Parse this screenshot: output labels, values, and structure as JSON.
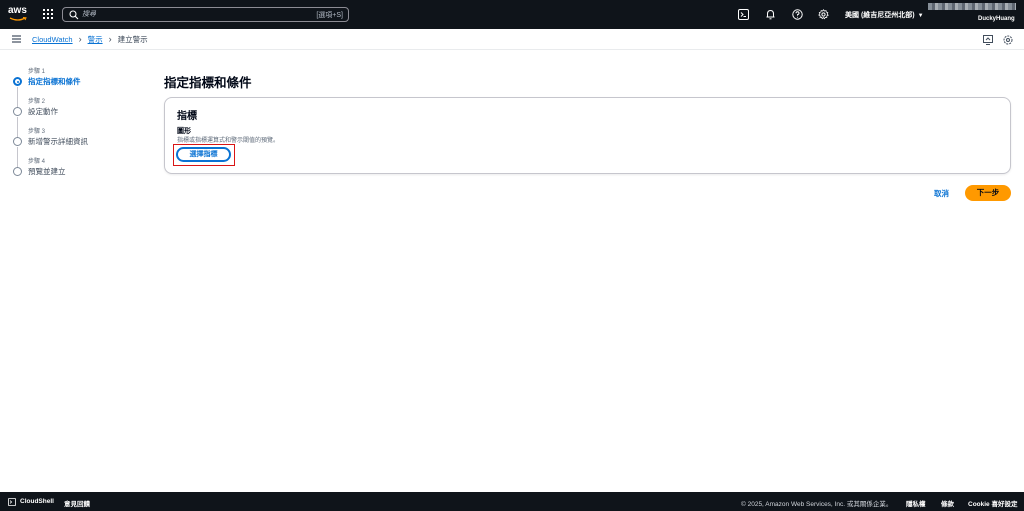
{
  "topnav": {
    "logo_text": "aws",
    "search_placeholder": "搜尋",
    "search_shortcut": "[選項+S]",
    "region": "美國 (維吉尼亞州北部)",
    "username": "DuckyHuang"
  },
  "breadcrumb": {
    "items": [
      "CloudWatch",
      "警示",
      "建立警示"
    ]
  },
  "steps": [
    {
      "num": "步驟 1",
      "label": "指定指標和條件",
      "active": true
    },
    {
      "num": "步驟 2",
      "label": "設定動作",
      "active": false
    },
    {
      "num": "步驟 3",
      "label": "新增警示詳細資訊",
      "active": false
    },
    {
      "num": "步驟 4",
      "label": "預覽並建立",
      "active": false
    }
  ],
  "main": {
    "title": "指定指標和條件",
    "card": {
      "title": "指標",
      "field_label": "圖形",
      "field_desc": "指標或指標運算式和警示閾值的預覽。",
      "button_label": "選擇指標"
    },
    "cancel_label": "取消",
    "next_label": "下一步"
  },
  "footer": {
    "cloudshell": "CloudShell",
    "feedback": "意見回饋",
    "copyright": "© 2025, Amazon Web Services, Inc. 或其關係企業。",
    "privacy": "隱私權",
    "terms": "條款",
    "cookie": "Cookie 喜好設定"
  },
  "colors": {
    "nav_bg": "#0f141a",
    "link_blue": "#0972d3",
    "primary_orange": "#ff9900",
    "highlight_red": "#d91515"
  }
}
